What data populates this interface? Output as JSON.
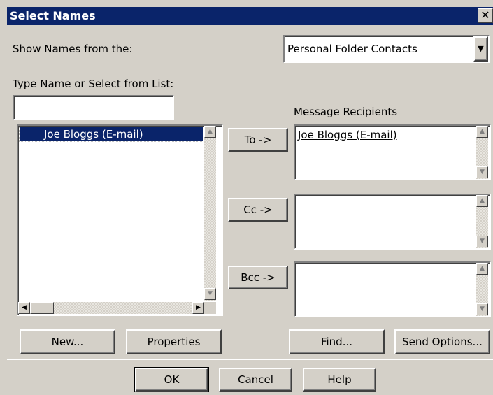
{
  "window": {
    "title": "Select Names",
    "close_glyph": "✕"
  },
  "show_names": {
    "label": "Show Names from the:",
    "selected": "Personal Folder Contacts"
  },
  "type_name": {
    "label": "Type Name or Select from List:",
    "value": ""
  },
  "name_list": {
    "items": [
      "Joe Bloggs (E-mail)"
    ]
  },
  "recipients": {
    "heading": "Message Recipients",
    "to_button": "To ->",
    "cc_button": "Cc ->",
    "bcc_button": "Bcc ->",
    "to_items": [
      "Joe Bloggs (E-mail)"
    ],
    "cc_items": [],
    "bcc_items": []
  },
  "actions": {
    "new": "New...",
    "properties": "Properties",
    "find": "Find...",
    "send_options": "Send Options..."
  },
  "footer": {
    "ok": "OK",
    "cancel": "Cancel",
    "help": "Help"
  },
  "colors": {
    "titlebar": "#0a246a",
    "face": "#d4d0c8",
    "selection": "#0a246a"
  }
}
